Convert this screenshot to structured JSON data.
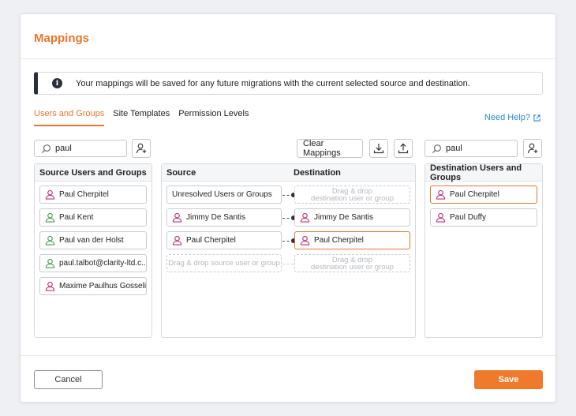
{
  "dialog": {
    "title": "Mappings",
    "banner": "Your mappings will be saved for any future migrations with the current selected source and destination."
  },
  "tabs": [
    {
      "label": "Users and Groups",
      "active": true
    },
    {
      "label": "Site Templates",
      "active": false
    },
    {
      "label": "Permission Levels",
      "active": false
    }
  ],
  "help": {
    "label": "Need Help?"
  },
  "source_search": {
    "value": "paul"
  },
  "dest_search": {
    "value": "paul"
  },
  "toolbar": {
    "clear_label": "Clear Mappings"
  },
  "source_panel": {
    "title": "Source Users and Groups",
    "users": [
      {
        "name": "Paul Cherpitel",
        "type": "pink"
      },
      {
        "name": "Paul Kent",
        "type": "green"
      },
      {
        "name": "Paul van der Holst",
        "type": "green"
      },
      {
        "name": "paul.talbot@clarity-ltd.c...",
        "type": "green"
      },
      {
        "name": "Maxime Paulhus Gosselin",
        "type": "pink"
      }
    ]
  },
  "mapping_panel": {
    "source_header": "Source",
    "dest_header": "Destination",
    "rows": [
      {
        "source": "Unresolved Users or Groups",
        "dest_drop": "Drag & drop\ndestination user or group"
      },
      {
        "source": "Jimmy De Santis",
        "dest": "Jimmy De Santis"
      },
      {
        "source": "Paul Cherpitel",
        "dest": "Paul Cherpitel"
      }
    ],
    "source_drop": "Drag & drop source user or group",
    "dest_drop": "Drag & drop\ndestination user or group"
  },
  "dest_panel": {
    "title": "Destination Users and Groups",
    "users": [
      {
        "name": "Paul Cherpitel",
        "type": "pink"
      },
      {
        "name": "Paul Duffy",
        "type": "pink"
      }
    ]
  },
  "footer": {
    "cancel_label": "Cancel",
    "save_label": "Save"
  },
  "colors": {
    "accent": "#e8762c",
    "pink_user": "#c2307a",
    "green_user": "#4f9a53",
    "link": "#2b87d1"
  }
}
